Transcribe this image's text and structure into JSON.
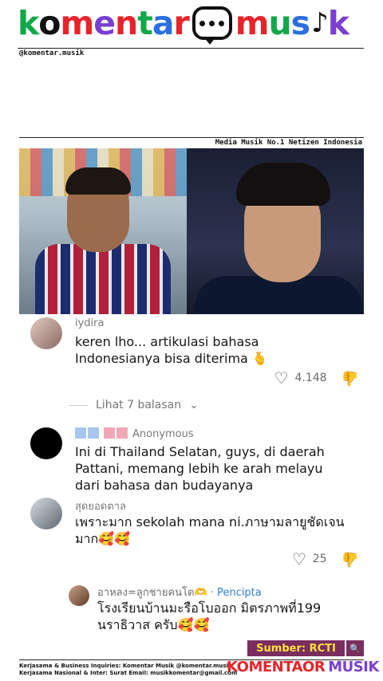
{
  "header": {
    "logo_letters": [
      {
        "ch": "k",
        "color": "#12a84a"
      },
      {
        "ch": "o",
        "color": "#111111"
      },
      {
        "ch": "m",
        "color": "#e8232a"
      },
      {
        "ch": "e",
        "color": "#7a3fd1"
      },
      {
        "ch": "n",
        "color": "#e8232a"
      },
      {
        "ch": "t",
        "color": "#12a84a"
      },
      {
        "ch": "a",
        "color": "#2b6fe0"
      },
      {
        "ch": "r",
        "color": "#e8232a"
      }
    ],
    "logo_letters_2": [
      {
        "ch": "m",
        "color": "#e8232a"
      },
      {
        "ch": "u",
        "color": "#12a84a"
      },
      {
        "ch": "s",
        "color": "#2b6fe0"
      },
      {
        "ch": "♪",
        "color": "#111111"
      },
      {
        "ch": "k",
        "color": "#7a3fd1"
      }
    ],
    "handle": "@komentar.musik"
  },
  "media": {
    "label": "Media Musik No.1 Netizen Indonesia"
  },
  "comments": [
    {
      "username": "iydira",
      "text": "keren lho... artikulasi bahasa Indonesianya bisa diterima 🫰",
      "likes": "4.148"
    },
    {
      "username": "Anonymous",
      "text": "Ini di Thailand Selatan, guys, di daerah Pattani, memang lebih ke arah melayu dari bahasa dan budayanya"
    },
    {
      "username": "สุดยอดตาล",
      "text": "เพราะมาก sekolah mana ni.ภาษามลายูชัดเจน มาก🥰🥰",
      "likes": "25"
    },
    {
      "username": "อาหลง=ลูกชายคนโต🫶",
      "creator_tag": "· Pencipta",
      "text": "โรงเรียนบ้านมะรือโบออก มิตรภาพที่199 นราธิวาส ครับ🥰🥰"
    }
  ],
  "replies_link": "Lihat 7 balasan",
  "source": {
    "label": "Sumber: RCTI",
    "icon": "search-icon"
  },
  "footer": {
    "line1": "Kerjasama & Business Inquiries: Komentar Musik @komentar.musik",
    "line2": "Kerjasama Nasional & Inter: Surat Email: musikkomentar@gmail.com",
    "logo_text_a": "KOMENTAOR",
    "logo_text_b": "MUSIK"
  },
  "colors": {
    "accent_blue": "#3a86d8",
    "source_bg": "#7a2d5e",
    "source_text": "#ffe23d",
    "creator_tag": "#2f7fd6"
  }
}
